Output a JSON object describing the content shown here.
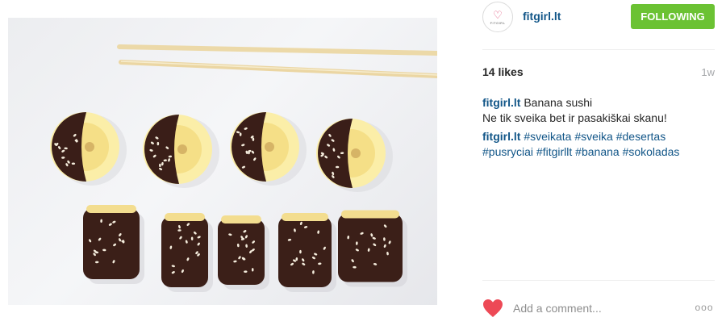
{
  "post": {
    "username": "fitgirl.lt",
    "avatar_text": "FITGIRL",
    "follow_label": "FOLLOWING",
    "likes": "14 likes",
    "time": "1w",
    "caption_user": "fitgirl.lt",
    "caption_text": "Banana sushi",
    "caption_line2": "Ne tik sveika bet ir pasakiškai skanu!",
    "tags_user": "fitgirl.lt",
    "tags": [
      "#sveikata",
      "#sveika",
      "#desertas",
      "#pusryciai",
      "#fitgirllt",
      "#banana",
      "#sokoladas"
    ]
  },
  "comment": {
    "placeholder": "Add a comment...",
    "more_label": "ooo"
  },
  "colors": {
    "link": "#125688",
    "follow_bg": "#6bc233",
    "heart": "#ed4956"
  }
}
